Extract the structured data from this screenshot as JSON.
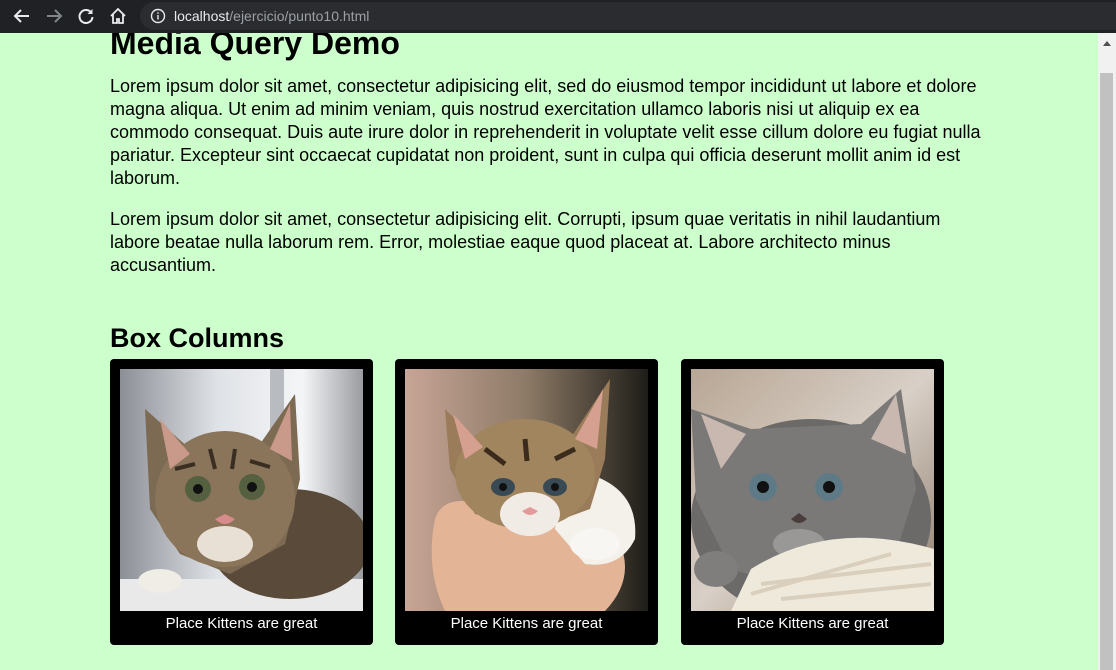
{
  "browser": {
    "url_host": "localhost",
    "url_path": "/ejercicio/punto10.html",
    "icons": [
      "back-arrow-icon",
      "forward-arrow-icon",
      "reload-icon",
      "home-icon",
      "info-icon"
    ]
  },
  "page": {
    "title": "Media Query Demo",
    "paragraph1": "Lorem ipsum dolor sit amet, consectetur adipisicing elit, sed do eiusmod tempor incididunt ut labore et dolore magna aliqua. Ut enim ad minim veniam, quis nostrud exercitation ullamco laboris nisi ut aliquip ex ea commodo consequat. Duis aute irure dolor in reprehenderit in voluptate velit esse cillum dolore eu fugiat nulla pariatur. Excepteur sint occaecat cupidatat non proident, sunt in culpa qui officia deserunt mollit anim id est laborum.",
    "paragraph2": "Lorem ipsum dolor sit amet, consectetur adipisicing elit. Corrupti, ipsum quae veritatis in nihil laudantium labore beatae nulla laborum rem. Error, molestiae eaque quod placeat at. Labore architecto minus accusantium.",
    "section_title": "Box Columns",
    "boxes": [
      {
        "caption": "Place Kittens are great"
      },
      {
        "caption": "Place Kittens are great"
      },
      {
        "caption": "Place Kittens are great"
      }
    ]
  },
  "colors": {
    "page_background": "#ccffcc",
    "box_background": "#000000",
    "chrome_background": "#202124"
  }
}
